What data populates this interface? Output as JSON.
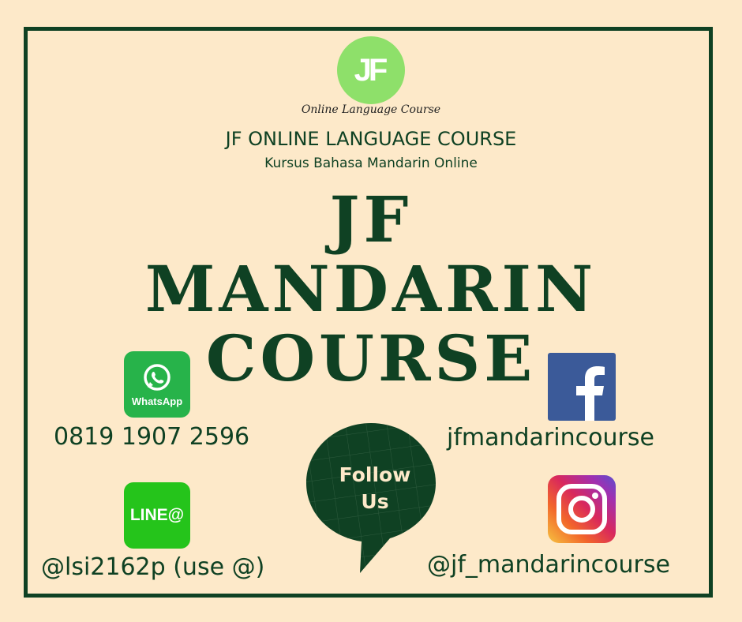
{
  "logo": {
    "text": "JF",
    "tagline": "Online Language Course"
  },
  "header": {
    "company": "JF ONLINE LANGUAGE COURSE",
    "subtitle": "Kursus Bahasa Mandarin Online"
  },
  "headline": {
    "line1": "JF",
    "line2": "MANDARIN",
    "line3": "COURSE"
  },
  "contacts": {
    "whatsapp": {
      "icon": "whatsapp-icon",
      "label": "WhatsApp",
      "value": "0819 1907 2596"
    },
    "line": {
      "icon": "line-icon",
      "label": "LINE@",
      "value": "@lsi2162p (use @)"
    },
    "facebook": {
      "icon": "facebook-icon",
      "value": "jfmandarincourse"
    },
    "instagram": {
      "icon": "instagram-icon",
      "value": "@jf_mandarincourse"
    }
  },
  "follow": {
    "line1": "Follow",
    "line2": "Us"
  },
  "colors": {
    "background": "#fde9c9",
    "brand_green": "#0f4123",
    "logo_green": "#8ee06a"
  }
}
